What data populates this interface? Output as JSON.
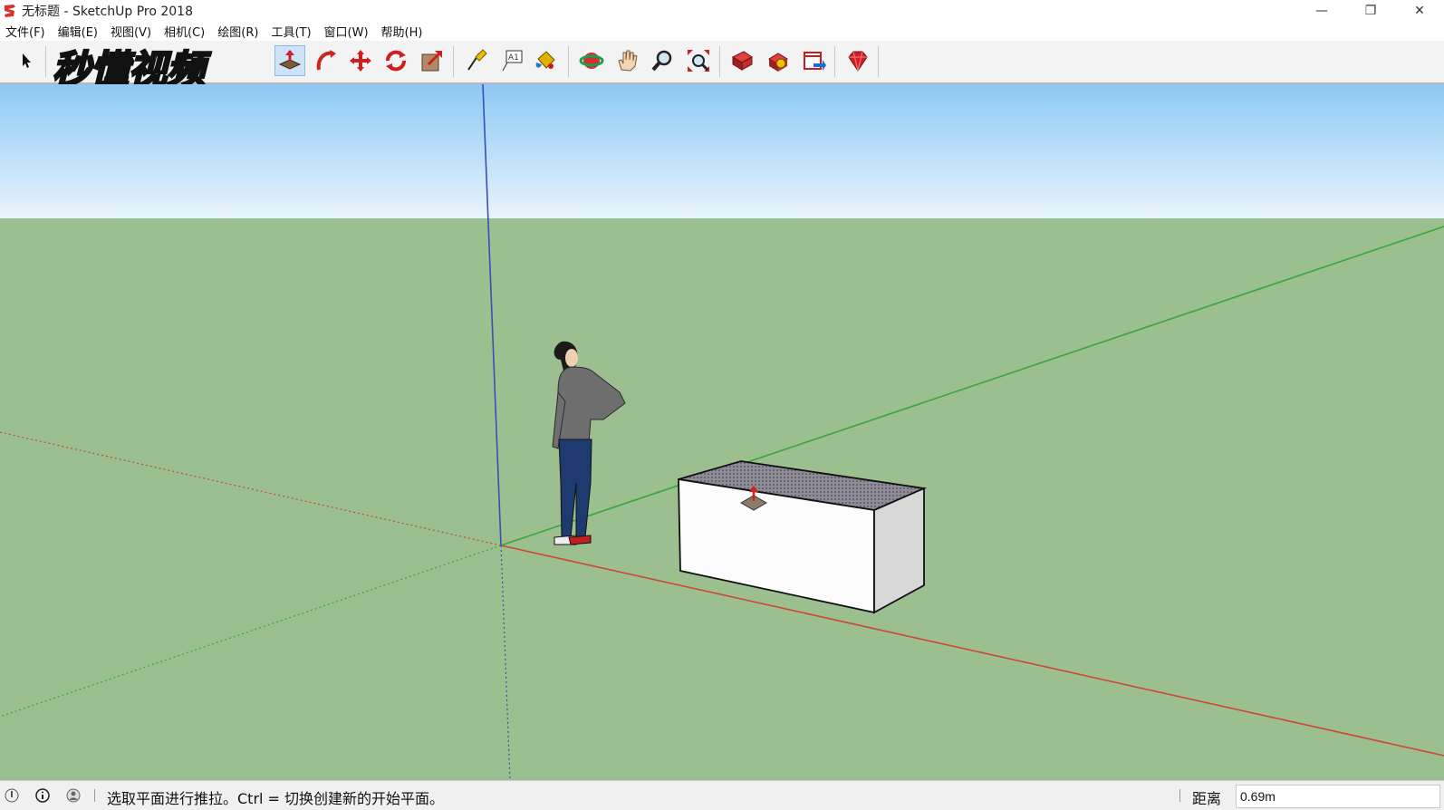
{
  "window": {
    "title": "无标题 - SketchUp Pro 2018",
    "controls": {
      "minimize": "—",
      "restore": "❐",
      "close": "✕"
    }
  },
  "menu": [
    {
      "label": "文件(F)"
    },
    {
      "label": "编辑(E)"
    },
    {
      "label": "视图(V)"
    },
    {
      "label": "相机(C)"
    },
    {
      "label": "绘图(R)"
    },
    {
      "label": "工具(T)"
    },
    {
      "label": "窗口(W)"
    },
    {
      "label": "帮助(H)"
    }
  ],
  "toolbar": {
    "active_tool": "push-pull",
    "tools": [
      "select",
      "push-pull",
      "follow-me",
      "move",
      "rotate",
      "scale",
      "tape-measure",
      "text",
      "paint-bucket",
      "orbit",
      "pan",
      "zoom",
      "zoom-extents",
      "warehouse",
      "extension-warehouse",
      "send-to-layout",
      "ruby"
    ],
    "watermark": "秒懂视频"
  },
  "viewport": {
    "colors": {
      "sky_top": "#8cc9f5",
      "sky_bottom": "#e9f4fc",
      "ground": "#9bbf8e",
      "axis_red": "#c8483a",
      "axis_green": "#3aa53a",
      "axis_blue": "#3a4fb5"
    }
  },
  "status": {
    "message": "选取平面进行推拉。Ctrl = 切换创建新的开始平面。",
    "measure_label": "距离",
    "measure_value": "0.69m"
  }
}
